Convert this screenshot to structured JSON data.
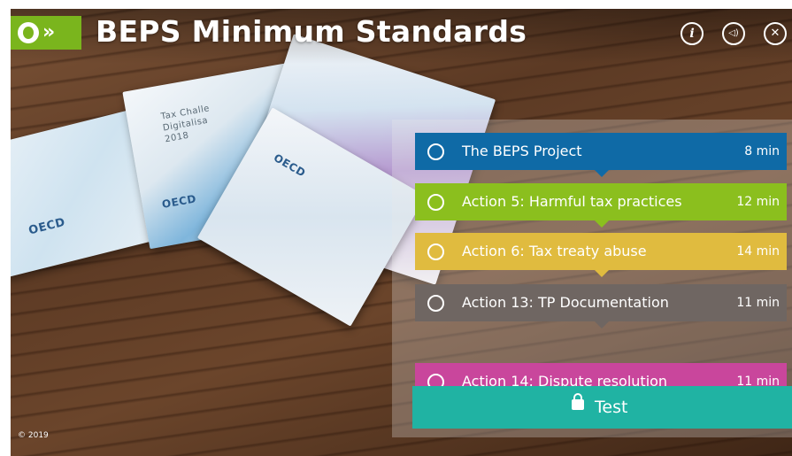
{
  "header": {
    "title": "BEPS Minimum Standards",
    "logo_glyph": "»",
    "icons": [
      "info-icon",
      "audio-icon",
      "close-icon"
    ],
    "info_glyph": "i",
    "audio_glyph": "◁)",
    "close_glyph": "✕"
  },
  "background": {
    "book_brand": "OECD",
    "book_title_lines": [
      "Tax Challe",
      "Digitalisa",
      "2018"
    ]
  },
  "modules": [
    {
      "label": "The BEPS Project",
      "duration": "8 min",
      "color": "#0f6aa6"
    },
    {
      "label": "Action 5: Harmful tax practices",
      "duration": "12 min",
      "color": "#8bbf1e"
    },
    {
      "label": "Action 6: Tax treaty abuse",
      "duration": "14 min",
      "color": "#e0bb3f"
    },
    {
      "label": "Action 13: TP Documentation",
      "duration": "11 min",
      "color": "#6f6662"
    },
    {
      "label": "Action 14: Dispute resolution",
      "duration": "11 min",
      "color": "#c9469c"
    }
  ],
  "test": {
    "label": "Test",
    "color": "#20b3a3"
  },
  "footer": {
    "copyright": "© 2019"
  }
}
